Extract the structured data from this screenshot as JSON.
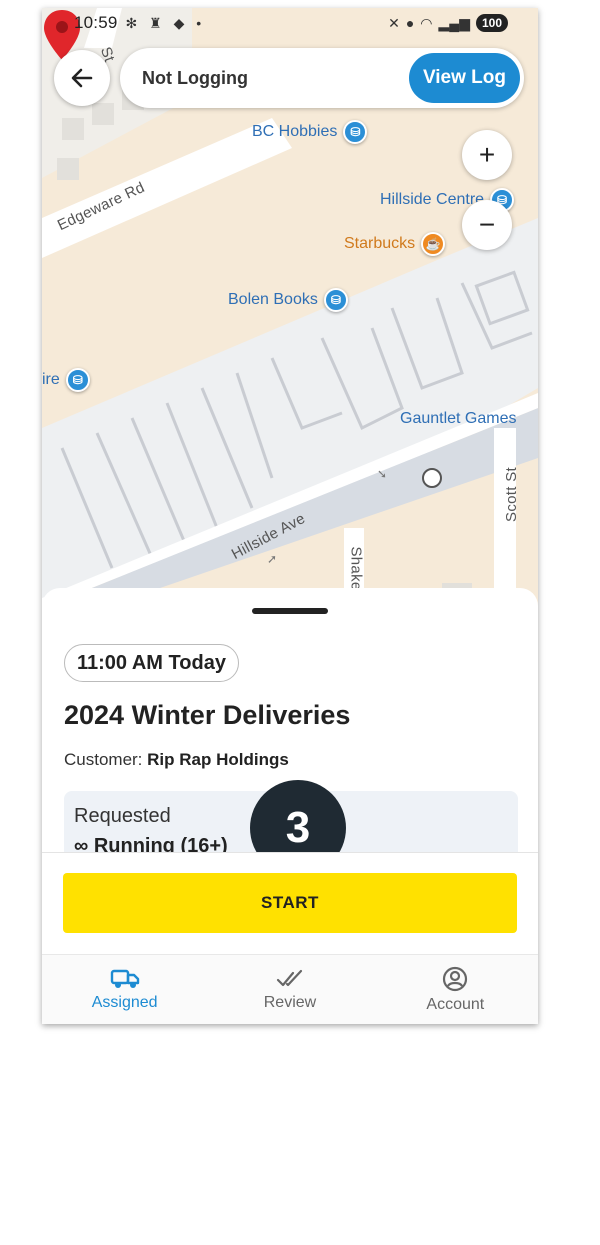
{
  "status_bar": {
    "time": "10:59",
    "battery": "100"
  },
  "header": {
    "back_icon": "arrow-left-icon",
    "logging_status": "Not Logging",
    "view_log_label": "View Log"
  },
  "map": {
    "zoom_in": "+",
    "zoom_out": "−",
    "pois": {
      "bc_hobbies": "BC Hobbies",
      "hillside_centre": "Hillside Centre",
      "starbucks": "Starbucks",
      "bolen_books": "Bolen Books",
      "ire": "ire",
      "gauntlet_games": "Gauntlet Games"
    },
    "streets": {
      "edgeware": "Edgeware Rd",
      "hillside": "Hillside Ave",
      "scott": "Scott St",
      "shake": "Shake",
      "top_st": "St"
    }
  },
  "job": {
    "time_chip": "11:00 AM Today",
    "title": "2024 Winter Deliveries",
    "customer_label": "Customer:",
    "customer_value": "Rip Rap Holdings",
    "requested_label": "Requested",
    "requested_value": "∞ Running (16+)"
  },
  "step_badge": "3",
  "actions": {
    "start_label": "START"
  },
  "bottom_nav": {
    "items": [
      {
        "label": "Assigned",
        "icon": "truck-icon"
      },
      {
        "label": "Review",
        "icon": "double-check-icon"
      },
      {
        "label": "Account",
        "icon": "account-icon"
      }
    ]
  },
  "colors": {
    "accent": "#1d8bd2",
    "start_button": "#ffe100",
    "marker": "#e0262b",
    "badge": "#1f2a33"
  }
}
